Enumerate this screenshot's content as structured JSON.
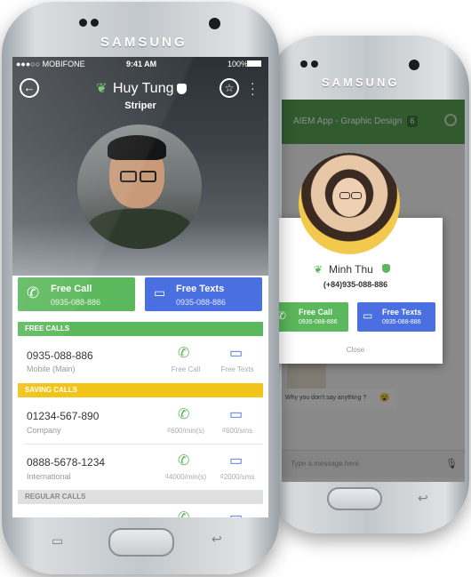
{
  "back_phone": {
    "brand": "SAMSUNG",
    "app_title": "AIEM App - Graphic Design",
    "app_badge": "6",
    "chat_message": "Why you don't say anything ?",
    "chat_emoji": "😮",
    "composer_placeholder": "Type a message here",
    "dialog": {
      "name": "Minh Thu",
      "phone": "(+84)935-088-886",
      "free_call_label": "Free Call",
      "free_call_number": "0935-088-886",
      "free_texts_label": "Free Texts",
      "free_texts_number": "0935-088-886",
      "close_label": "Close"
    }
  },
  "front_phone": {
    "brand": "SAMSUNG",
    "status": {
      "carrier": "●●●○○ MOBIFONE",
      "time": "9:41 AM",
      "battery": "100%"
    },
    "profile": {
      "name": "Huy Tung",
      "role": "Striper"
    },
    "free_call": {
      "label": "Free Call",
      "number": "0935-088-886"
    },
    "free_texts": {
      "label": "Free Texts",
      "number": "0935-088-886"
    },
    "sections": {
      "free_calls": "FREE CALLS",
      "saving_calls": "SAVING CALLS",
      "regular_calls": "REGULAR CALLS"
    },
    "rows": [
      {
        "number": "0935-088-886",
        "type": "Mobile (Main)",
        "call_cap": "Free Call",
        "text_cap": "Free Texts"
      },
      {
        "number": "01234-567-890",
        "type": "Company",
        "call_cap": "₫600/min(s)",
        "text_cap": "₫600/sms"
      },
      {
        "number": "0888-5678-1234",
        "type": "International",
        "call_cap": "₫4000/min(s)",
        "text_cap": "₫2000/sms"
      }
    ]
  },
  "colors": {
    "green": "#5cb85c",
    "blue": "#4a6fe0",
    "yellow": "#f2c319",
    "gray_bar": "#e0e0e0"
  }
}
